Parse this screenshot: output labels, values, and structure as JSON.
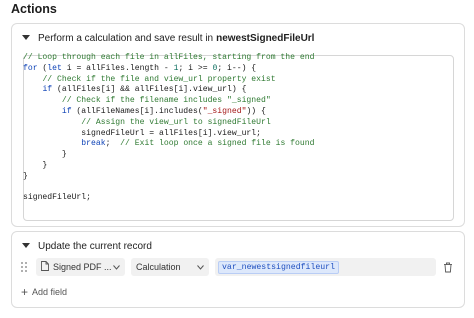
{
  "page": {
    "title": "Actions"
  },
  "action1": {
    "prefix": "Perform a calculation",
    "middle": "and save result in",
    "target": "newestSignedFileUrl",
    "code_lines": [
      [
        {
          "t": "c",
          "v": "// Loop through each file in allFiles, starting from the end"
        }
      ],
      [
        {
          "t": "k",
          "v": "for"
        },
        {
          "t": "p",
          "v": " ("
        },
        {
          "t": "k",
          "v": "let"
        },
        {
          "t": "p",
          "v": " i = allFiles.length - "
        },
        {
          "t": "n",
          "v": "1"
        },
        {
          "t": "p",
          "v": "; i >= "
        },
        {
          "t": "n",
          "v": "0"
        },
        {
          "t": "p",
          "v": "; i--) {"
        }
      ],
      [
        {
          "t": "p",
          "v": "    "
        },
        {
          "t": "c",
          "v": "// Check if the file and view_url property exist"
        }
      ],
      [
        {
          "t": "p",
          "v": "    "
        },
        {
          "t": "k",
          "v": "if"
        },
        {
          "t": "p",
          "v": " (allFiles[i] && allFiles[i].view_url) {"
        }
      ],
      [
        {
          "t": "p",
          "v": "        "
        },
        {
          "t": "c",
          "v": "// Check if the filename includes \"_signed\""
        }
      ],
      [
        {
          "t": "p",
          "v": "        "
        },
        {
          "t": "k",
          "v": "if"
        },
        {
          "t": "p",
          "v": " (allFileNames[i].includes("
        },
        {
          "t": "s",
          "v": "\"_signed\""
        },
        {
          "t": "p",
          "v": ")) {"
        }
      ],
      [
        {
          "t": "p",
          "v": "            "
        },
        {
          "t": "c",
          "v": "// Assign the view_url to signedFileUrl"
        }
      ],
      [
        {
          "t": "p",
          "v": "            signedFileUrl = allFiles[i].view_url;"
        }
      ],
      [
        {
          "t": "p",
          "v": "            "
        },
        {
          "t": "k",
          "v": "break"
        },
        {
          "t": "p",
          "v": ";  "
        },
        {
          "t": "c",
          "v": "// Exit loop once a signed file is found"
        }
      ],
      [
        {
          "t": "p",
          "v": "        }"
        }
      ],
      [
        {
          "t": "p",
          "v": "    }"
        }
      ],
      [
        {
          "t": "p",
          "v": "}"
        }
      ],
      [
        {
          "t": "p",
          "v": ""
        }
      ],
      [
        {
          "t": "p",
          "v": "signedFileUrl;"
        }
      ]
    ]
  },
  "action2": {
    "title": "Update the current record",
    "field_select": "Signed PDF ...",
    "value_type": "Calculation",
    "variable": "var_newestsignedfileurl",
    "add_field_label": "Add field"
  },
  "icons": {
    "collapse": "chevron-down-icon",
    "grip": "drag-grip-icon",
    "document": "document-icon",
    "caret": "caret-down-icon",
    "delete": "trash-icon",
    "add": "plus-icon"
  },
  "colors": {
    "comment": "#2f7a32",
    "keyword": "#0a3fb5",
    "string": "#a31515",
    "number": "#0c6e5e",
    "variable_pill": "#1f4fbf"
  }
}
